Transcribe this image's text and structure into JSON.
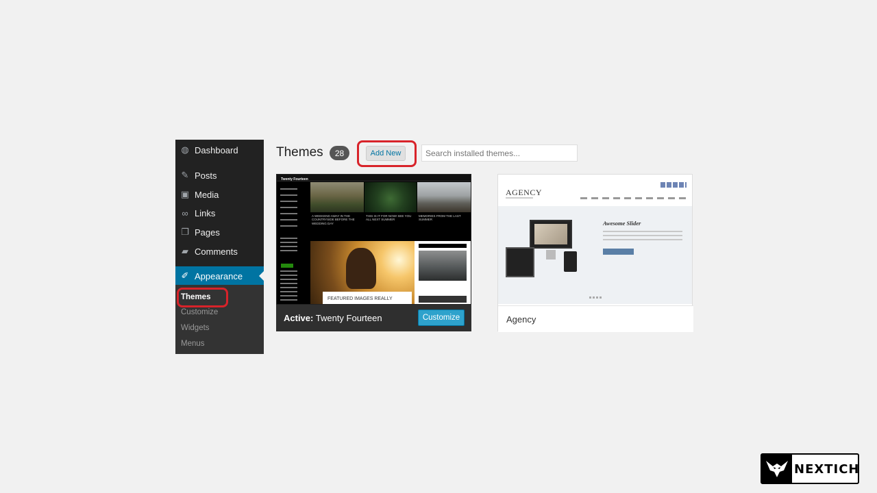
{
  "sidebar": {
    "items": [
      {
        "label": "Dashboard",
        "icon": "dashboard-icon"
      },
      {
        "label": "Posts",
        "icon": "pin-icon"
      },
      {
        "label": "Media",
        "icon": "media-icon"
      },
      {
        "label": "Links",
        "icon": "link-icon"
      },
      {
        "label": "Pages",
        "icon": "pages-icon"
      },
      {
        "label": "Comments",
        "icon": "comment-icon"
      },
      {
        "label": "Appearance",
        "icon": "brush-icon"
      }
    ],
    "submenu": [
      "Themes",
      "Customize",
      "Widgets",
      "Menus"
    ]
  },
  "header": {
    "title": "Themes",
    "count": "28",
    "add_new": "Add New",
    "search_placeholder": "Search installed themes..."
  },
  "themes": [
    {
      "name": "Twenty Fourteen",
      "active_prefix": "Active:",
      "button": "Customize",
      "preview": {
        "brand": "Twenty Fourteen",
        "captions": [
          "A WEEKEND AWAY IN THE COUNTRYSIDE BEFORE THE WEDDING DAY",
          "THIS IS IT FOR NOW! SEE YOU ALL NEXT SUMMER",
          "MEMORIES FROM THE LAST SUMMER"
        ],
        "featured": "FEATURED IMAGES REALLY"
      }
    },
    {
      "name": "Agency",
      "preview": {
        "logo": "AGENCY",
        "slider_title": "Awesome Slider"
      }
    }
  ],
  "brand": {
    "name": "NEXTICH"
  },
  "colors": {
    "sidebar": "#222222",
    "current": "#0074a2",
    "highlight": "#d8232a",
    "button": "#2ea2cc"
  }
}
